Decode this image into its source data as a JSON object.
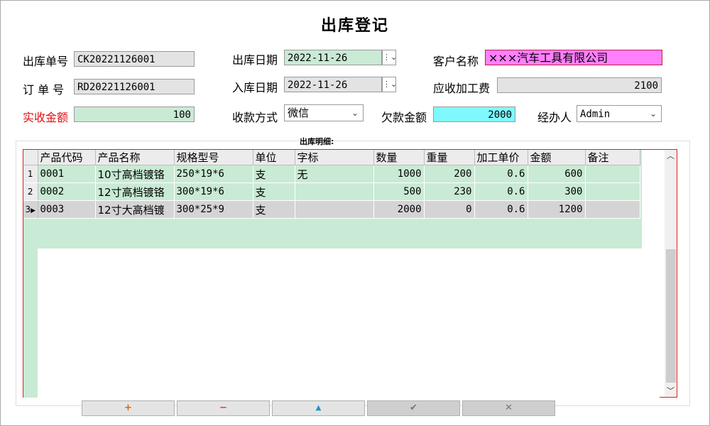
{
  "title": "出库登记",
  "header": {
    "outbound_no_label": "出库单号",
    "outbound_no": "CK20221126001",
    "order_no_label": "订 单 号",
    "order_no": "RD20221126001",
    "received_amount_label": "实收金额",
    "received_amount": "100",
    "outbound_date_label": "出库日期",
    "outbound_date": "2022-11-26",
    "inbound_date_label": "入库日期",
    "inbound_date": "2022-11-26",
    "payment_method_label": "收款方式",
    "payment_method": "微信",
    "owed_amount_label": "欠款金额",
    "owed_amount": "2000",
    "customer_label": "客户名称",
    "customer": "×××汽车工具有限公司",
    "processing_fee_label": "应收加工费",
    "processing_fee": "2100",
    "handler_label": "经办人",
    "handler": "Admin"
  },
  "details_label": "出库明细:",
  "table": {
    "columns": [
      "产品代码",
      "产品名称",
      "规格型号",
      "单位",
      "字标",
      "数量",
      "重量",
      "加工单价",
      "金额",
      "备注"
    ],
    "rows": [
      {
        "idx": "1",
        "code": "0001",
        "name": "10寸高档镀铬",
        "spec": "250*19*6",
        "unit": "支",
        "mark": "无",
        "qty": "1000",
        "weight": "200",
        "price": "0.6",
        "amount": "600",
        "note": ""
      },
      {
        "idx": "2",
        "code": "0002",
        "name": "12寸高档镀铬",
        "spec": "300*19*6",
        "unit": "支",
        "mark": "",
        "qty": "500",
        "weight": "230",
        "price": "0.6",
        "amount": "300",
        "note": ""
      },
      {
        "idx": "3",
        "code": "0003",
        "name": "12寸大高档镀",
        "spec": "300*25*9",
        "unit": "支",
        "mark": "",
        "qty": "2000",
        "weight": "0",
        "price": "0.6",
        "amount": "1200",
        "note": ""
      }
    ]
  },
  "buttons": {
    "add": "+",
    "remove": "−",
    "up": "▲",
    "confirm": "✔",
    "cancel": "✕"
  },
  "colors": {
    "pink_field": "#ff80ff",
    "cyan_field": "#7ff8ff",
    "green_field": "#c9ead4",
    "red_label": "#e01010",
    "add_icon": "#e06010",
    "remove_icon": "#e04020",
    "up_icon": "#2090c0"
  }
}
